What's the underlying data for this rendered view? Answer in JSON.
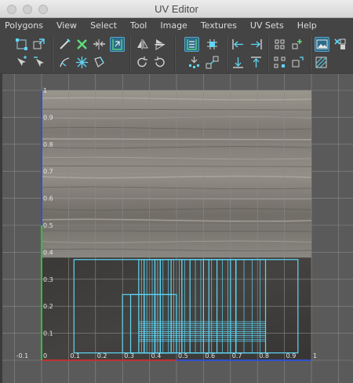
{
  "window": {
    "title": "UV Editor",
    "controls": [
      "close",
      "minimize",
      "zoom"
    ]
  },
  "menu": [
    "Polygons",
    "View",
    "Select",
    "Tool",
    "Image",
    "Textures",
    "UV Sets",
    "Help"
  ],
  "toolbar": {
    "row1": [
      "uv-select-icon",
      "move-uv-icon",
      "cut-uv-icon",
      "sew-uv-icon",
      "unfold-icon",
      "flip-u-icon",
      "flip-v-icon",
      "layout-icon",
      "distribute-icon",
      "align-left-icon",
      "align-right-icon",
      "grid-snap-icon",
      "add-uv-icon",
      "image-display-icon",
      "checker-icon"
    ],
    "row2": [
      "select-shell-icon",
      "select-border-icon",
      "smooth-icon",
      "relax-icon",
      "straighten-icon",
      "rotate-ccw-icon",
      "rotate-cw-icon",
      "stack-icon",
      "unstack-icon",
      "align-down-icon",
      "align-up-icon",
      "shell-grid-icon",
      "shell-square-icon",
      "dim-image-icon"
    ]
  },
  "viewport": {
    "u_ticks": [
      "-0.1",
      "0",
      "0.1",
      "0.2",
      "0.3",
      "0.4",
      "0.5",
      "0.6",
      "0.7",
      "0.8",
      "0.9",
      "1"
    ],
    "v_ticks": [
      "0.1",
      "0.2",
      "0.3",
      "0.4",
      "0.5",
      "0.6",
      "0.7",
      "0.8",
      "0.9",
      "1"
    ],
    "colors": {
      "background": "#5a5a5a",
      "grid": "#8a8a8a",
      "uv_shell": "#5fd6f5",
      "u_axis": "#c03030",
      "v_axis": "#3050d0",
      "v_axis_green": "#30c040",
      "wood_light": "#8c8880",
      "wood_dark": "#3d3c3b"
    }
  }
}
